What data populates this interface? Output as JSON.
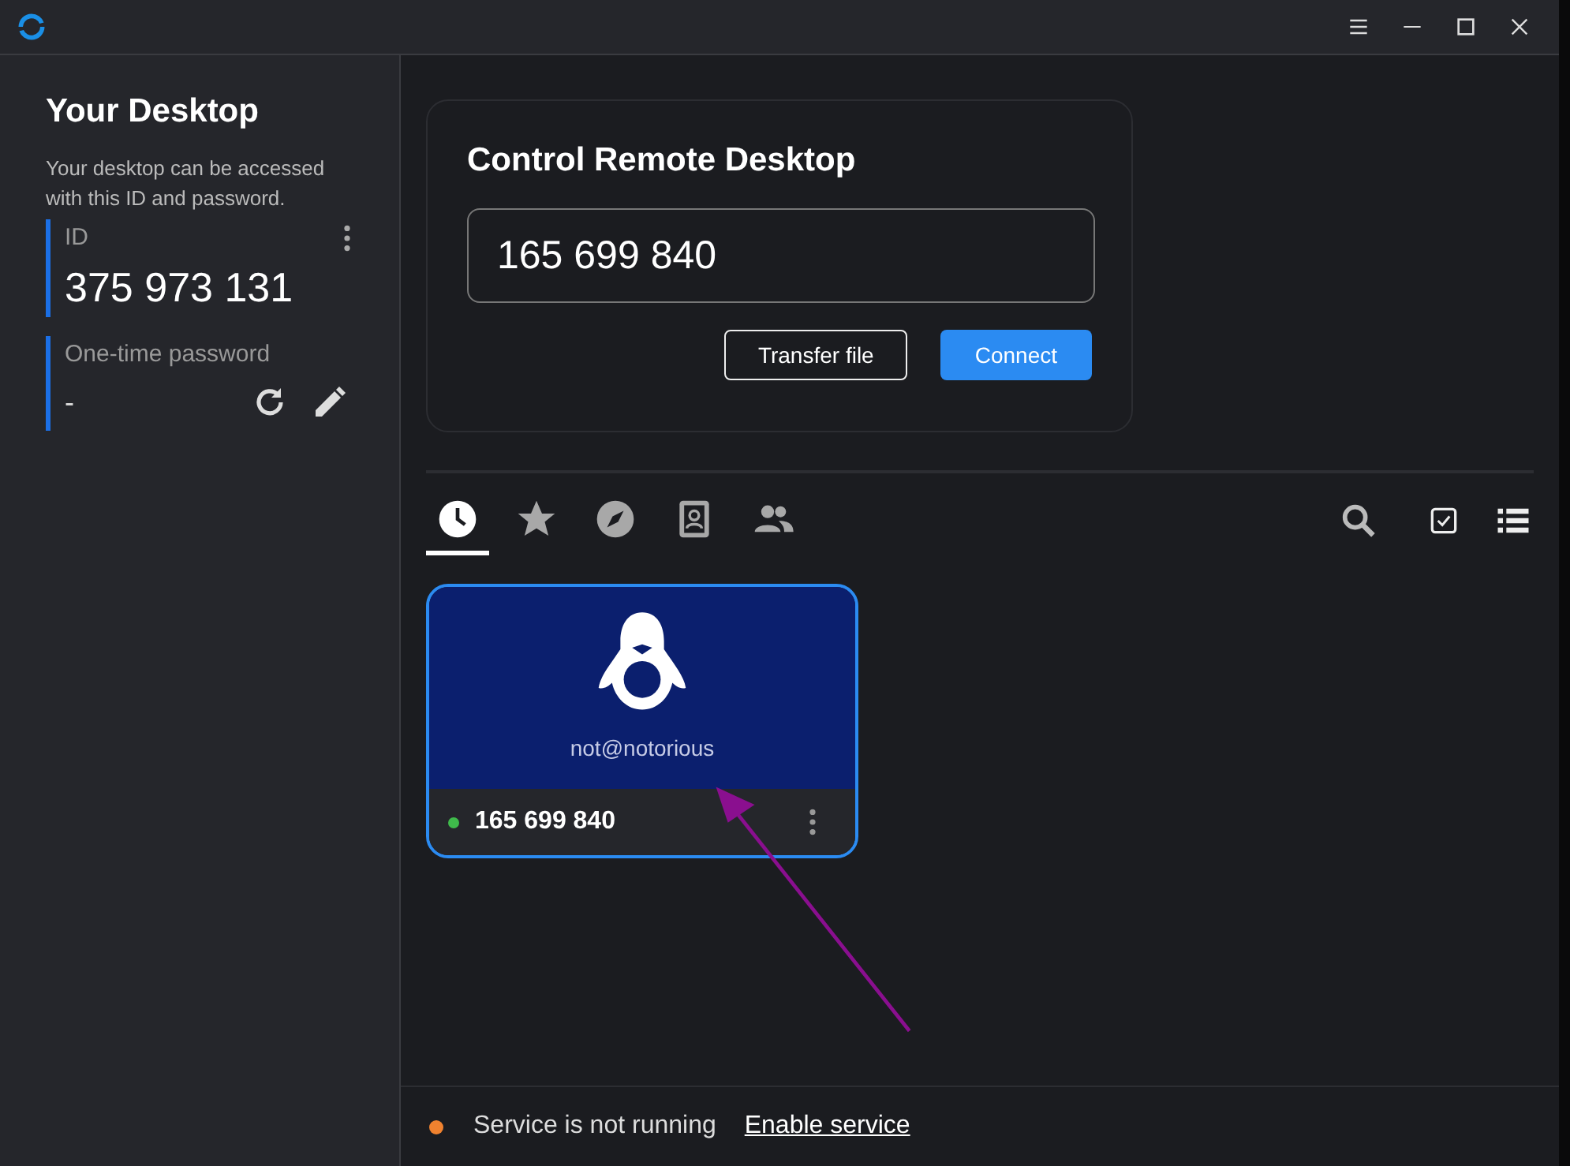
{
  "window": {
    "controls": [
      {
        "kind": "menu"
      },
      {
        "kind": "minimize"
      },
      {
        "kind": "maximize"
      },
      {
        "kind": "close"
      }
    ]
  },
  "sidebar": {
    "title": "Your Desktop",
    "description": "Your desktop can be accessed with this ID and password.",
    "id_label": "ID",
    "id_value": "375 973 131",
    "password_label": "One-time password",
    "password_value": "-"
  },
  "connect": {
    "title": "Control Remote Desktop",
    "value": "165 699 840",
    "buttons": [
      {
        "label": "Transfer file",
        "kind": "outline"
      },
      {
        "label": "Connect",
        "kind": "primary"
      }
    ]
  },
  "tabs": [
    {
      "kind": "recent",
      "selected": true
    },
    {
      "kind": "favorites",
      "selected": false
    },
    {
      "kind": "discovered",
      "selected": false
    },
    {
      "kind": "address-book",
      "selected": false
    },
    {
      "kind": "group",
      "selected": false
    }
  ],
  "view_options": [
    {
      "kind": "search"
    },
    {
      "kind": "select"
    },
    {
      "kind": "list"
    }
  ],
  "peers": [
    {
      "name": "not@notorious",
      "id": "165 699 840",
      "online": true,
      "selected": true
    }
  ],
  "status_bar": {
    "color": "#f0822f",
    "text": "Service is not running",
    "link": "Enable service"
  }
}
